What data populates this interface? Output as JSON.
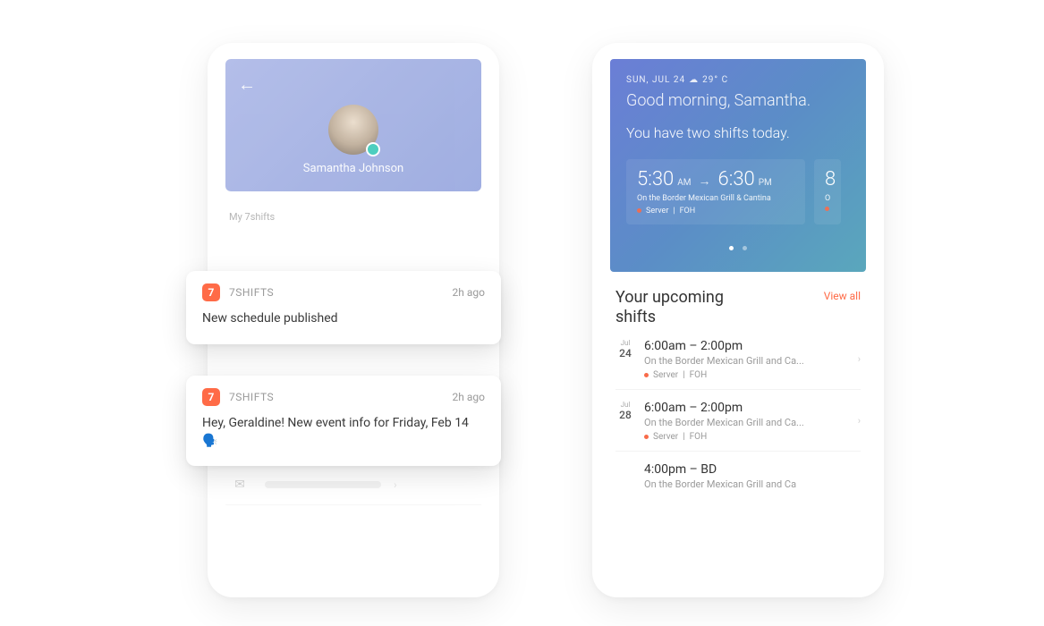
{
  "left": {
    "profile": {
      "name": "Samantha Johnson",
      "section_label": "My 7shifts"
    },
    "notifications": [
      {
        "app": "7SHIFTS",
        "time": "2h ago",
        "body": "New schedule published"
      },
      {
        "app": "7SHIFTS",
        "time": "2h ago",
        "body": "Hey, Geraldine! New event info for Friday, Feb 14 🗣️"
      }
    ]
  },
  "right": {
    "hero": {
      "date": "SUN, JUL 24",
      "temp": "29° C",
      "greeting": "Good morning, Samantha.",
      "message": "You have two shifts today.",
      "cards": [
        {
          "start": "5:30",
          "start_ampm": "AM",
          "end": "6:30",
          "end_ampm": "PM",
          "location": "On the Border Mexican Grill & Cantina",
          "role": "Server",
          "dept": "FOH"
        },
        {
          "start": "8",
          "location": "O"
        }
      ]
    },
    "upcoming": {
      "title": "Your upcoming shifts",
      "view_all": "View all",
      "rows": [
        {
          "mon": "Jul",
          "day": "24",
          "range": "6:00am – 2:00pm",
          "venue": "On the Border Mexican Grill and Ca...",
          "role": "Server",
          "dept": "FOH"
        },
        {
          "mon": "Jul",
          "day": "28",
          "range": "6:00am – 2:00pm",
          "venue": "On the Border Mexican Grill and Ca...",
          "role": "Server",
          "dept": "FOH"
        },
        {
          "mon": "",
          "day": "",
          "range": "4:00pm – BD",
          "venue": "On the Border Mexican Grill and Ca",
          "role": "",
          "dept": ""
        }
      ]
    }
  }
}
